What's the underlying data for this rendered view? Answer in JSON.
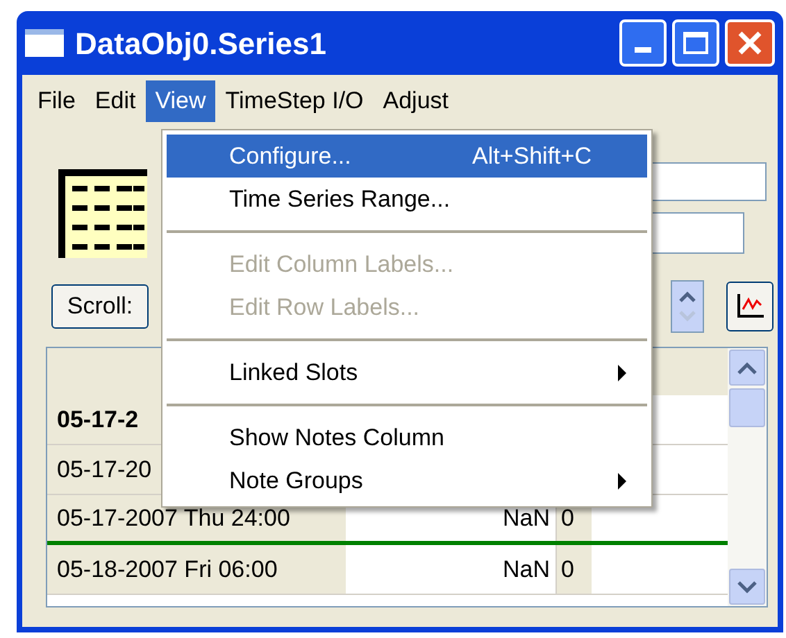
{
  "window": {
    "title": "DataObj0.Series1"
  },
  "menu_bar": [
    {
      "label": "File",
      "selected": false
    },
    {
      "label": "Edit",
      "selected": false
    },
    {
      "label": "View",
      "selected": true
    },
    {
      "label": "TimeStep I/O",
      "selected": false
    },
    {
      "label": "Adjust",
      "selected": false
    }
  ],
  "dropdown": [
    {
      "kind": "item",
      "label": "Configure...",
      "shortcut": "Alt+Shift+C",
      "selected": true,
      "disabled": false,
      "submenu": false
    },
    {
      "kind": "item",
      "label": "Time Series Range...",
      "selected": false,
      "disabled": false,
      "submenu": false
    },
    {
      "kind": "separator"
    },
    {
      "kind": "item",
      "label": "Edit Column Labels...",
      "selected": false,
      "disabled": true,
      "submenu": false
    },
    {
      "kind": "item",
      "label": "Edit Row Labels...",
      "selected": false,
      "disabled": true,
      "submenu": false
    },
    {
      "kind": "separator"
    },
    {
      "kind": "item",
      "label": "Linked Slots",
      "selected": false,
      "disabled": false,
      "submenu": true
    },
    {
      "kind": "separator"
    },
    {
      "kind": "item",
      "label": "Show Notes Column",
      "selected": false,
      "disabled": false,
      "submenu": false
    },
    {
      "kind": "item",
      "label": "Note Groups",
      "selected": false,
      "disabled": false,
      "submenu": true
    }
  ],
  "scroll_button": "Scroll:",
  "table": {
    "rows": [
      {
        "label": "05-17-2",
        "bold": true,
        "marked": false
      },
      {
        "label": "05-17-20",
        "bold": false,
        "marked": false
      },
      {
        "label": "05-17-2007 Thu 24:00",
        "value": "NaN",
        "flag": "0",
        "bold": false,
        "marked": true
      },
      {
        "label": "05-18-2007 Fri 06:00",
        "value": "NaN",
        "flag": "0",
        "bold": false,
        "marked": false
      }
    ]
  }
}
